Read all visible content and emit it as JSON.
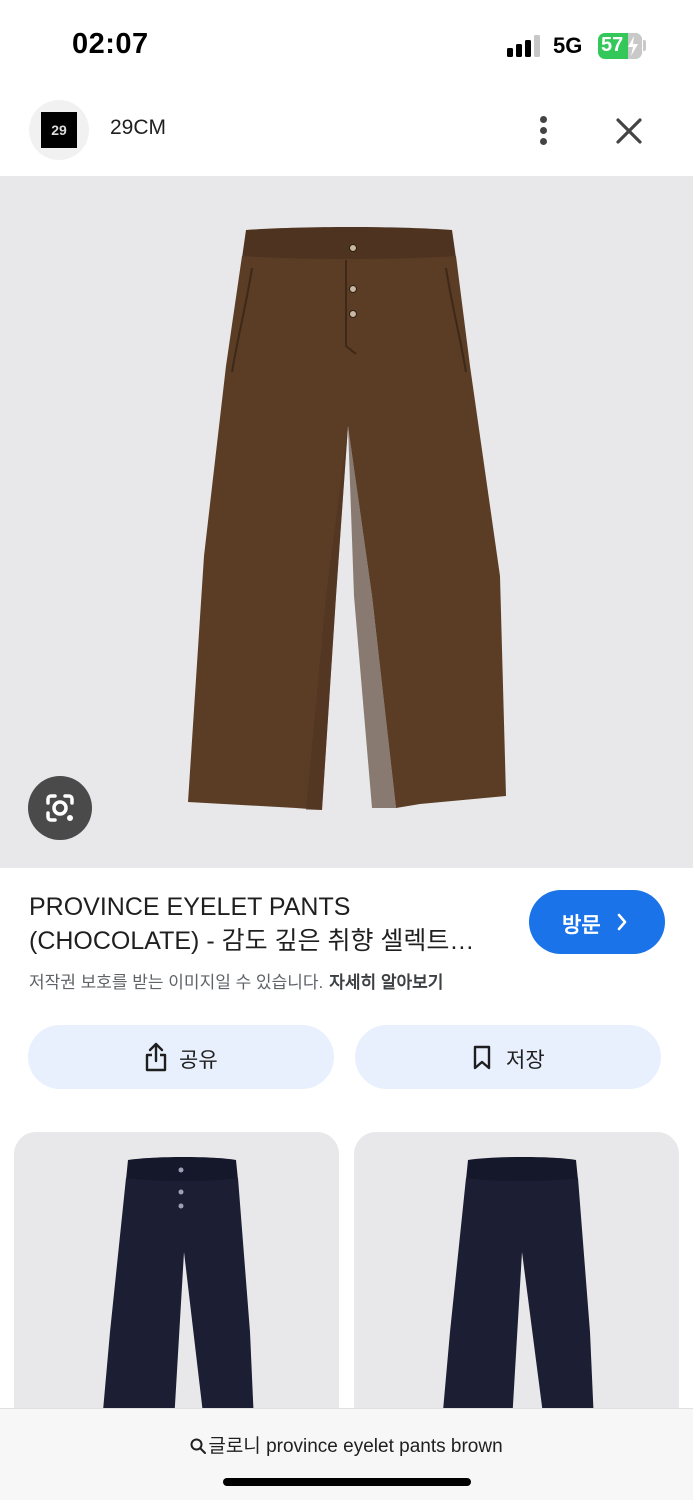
{
  "status_bar": {
    "time": "02:07",
    "network": "5G",
    "battery": "57",
    "signal_bars_active": 3,
    "signal_bars_total": 4
  },
  "source": {
    "favicon_text": "29",
    "site_name": "29CM",
    "more_icon": "more-vertical-icon",
    "close_icon": "close-icon"
  },
  "hero": {
    "product_color": "#5b3d26",
    "lens_icon": "google-lens-icon"
  },
  "result": {
    "title_line1": "PROVINCE EYELET PANTS",
    "title_line2": "(CHOCOLATE) - 감도 깊은 취향 셀렉트…",
    "visit_label": "방문",
    "copyright_notice": "저작권 보호를 받는 이미지일 수 있습니다.",
    "learn_more": "자세히 알아보기"
  },
  "actions": {
    "share_label": "공유",
    "save_label": "저장"
  },
  "related": [
    {
      "color": "#1c1e33",
      "has_buttons": true
    },
    {
      "color": "#1c1e33",
      "has_buttons": false
    }
  ],
  "search": {
    "query": "글로니 province eyelet pants brown"
  },
  "colors": {
    "accent": "#1a73e8",
    "action_bg": "#e8f0fe",
    "battery_green": "#34c759"
  }
}
